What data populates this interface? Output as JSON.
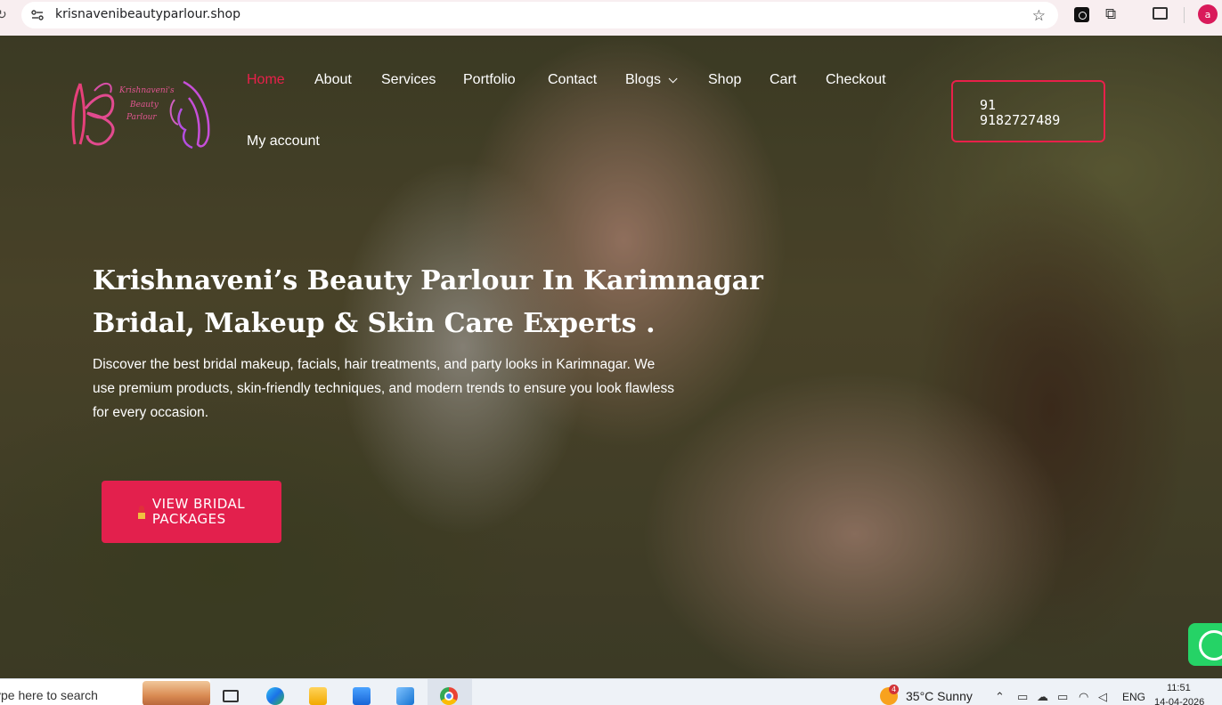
{
  "browser": {
    "url": "krisnavenibeautyparlour.shop",
    "profile_initial": "a"
  },
  "nav": {
    "items": [
      "Home",
      "About",
      "Services",
      "Portfolio",
      "Contact",
      "Blogs",
      "Shop",
      "Cart",
      "Checkout",
      "My account"
    ],
    "active": "Home"
  },
  "logo": {
    "text_line1": "Krishnaveni's",
    "text_line2": "Beauty",
    "text_line3": "Parlour",
    "monogram": "KB"
  },
  "phone": {
    "line1": "91",
    "line2": "9182727489"
  },
  "hero": {
    "title_line1": "Krishnaveni’s Beauty Parlour In Karimnagar",
    "title_line2": "Bridal, Makeup & Skin Care Experts .",
    "description": "Discover the best bridal makeup, facials, hair treatments, and party looks in Karimnagar. We use premium products, skin-friendly techniques, and modern trends to ensure you look flawless for every occasion.",
    "cta_line1": "VIEW BRIDAL",
    "cta_line2": "PACKAGES"
  },
  "taskbar": {
    "search_placeholder": "ype here to search",
    "weather_badge": "4",
    "weather": "35°C  Sunny",
    "language": "ENG",
    "time": "11:51",
    "date": "14-04-2026"
  },
  "colors": {
    "accent": "#e8204a",
    "button": "#e3204d",
    "browser_bar": "#f8eef0"
  }
}
